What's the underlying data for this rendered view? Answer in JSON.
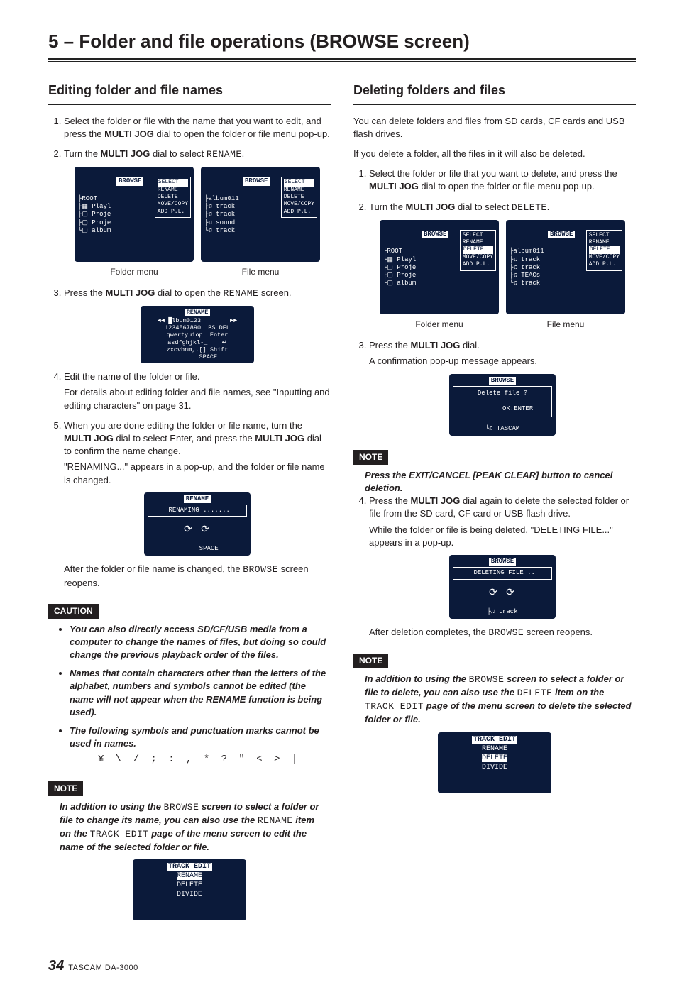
{
  "chapter": "5 – Folder and file operations (BROWSE screen)",
  "left": {
    "heading": "Editing folder and file names",
    "step1a": "Select the folder or file with the name that you want to edit, and press the ",
    "step1b": "MULTI JOG",
    "step1c": " dial to open the folder or file menu pop-up.",
    "step2a": "Turn the ",
    "step2c": " dial to select ",
    "rename_mono": "RENAME",
    "step2e": ".",
    "lcd1": {
      "title": "BROWSE",
      "lines": "├ROOT\n├▦ Playl\n├▢ Proje\n├▢ Proje\n└▢ album",
      "popup": [
        "SELECT",
        "RENAME",
        "DELETE",
        "MOVE/COPY",
        "ADD P.L."
      ]
    },
    "lcd2": {
      "title": "BROWSE",
      "lines": "├album011\n├♫ track\n├♫ track\n├♫ sound\n└♫ track",
      "popup": [
        "SELECT",
        "RENAME",
        "DELETE",
        "MOVE/COPY",
        "ADD P.L."
      ]
    },
    "cap_folder": "Folder menu",
    "cap_file": "File menu",
    "step3a": "Press the ",
    "step3c": " dial to open the ",
    "step3e": " screen.",
    "lcd_kbd_title": "RENAME",
    "lcd_kbd": "◄◄ █lbum0123        ►►\n1234567890  BS DEL\nqwertyuiop  Enter\nasdfghjkl-_    ↵\nzxcvbnm,.[] Shift\n      SPACE",
    "step4a": "Edit the name of the folder or file.",
    "step4b": "For details about editing folder and file names, see \"Inputting and editing characters\" on page 31.",
    "step5a": "When you are done editing the folder or file name, turn the ",
    "step5c": " dial to select Enter, and press the ",
    "step5e": " dial to confirm the name change.",
    "step5f": "\"RENAMING...\" appears in a pop-up, and the folder or file name is changed.",
    "lcd_renaming_title": "RENAME",
    "lcd_renaming_line": " RENAMING .......",
    "spinner": "⟳ ⟳",
    "lcd_renaming_footer": "      SPACE",
    "after_rename_a": "After the folder or file name is changed, the ",
    "browse_mono": "BROWSE",
    "after_rename_b": " screen reopens.",
    "caution_label": "CAUTION",
    "caution1": "You can also directly access SD/CF/USB media from a computer to change the names of files, but doing so could change the previous playback order of the files.",
    "caution2": "Names that contain characters other than the letters of the alphabet, numbers and symbols cannot be edited (the name will not appear when the RENAME function is being used).",
    "caution3": "The following symbols and punctuation marks cannot be used in names.",
    "symbols": "¥ \\ / ; : , * ? \" < > |",
    "note_label": "NOTE",
    "note_a": "In addition to using the ",
    "note_b": " screen to select a folder or file to change its name, you can also use the ",
    "note_c": " item on the ",
    "track_edit_mono": "TRACK EDIT",
    "note_d": " page of the menu screen to edit the name of the selected folder or file.",
    "lcd_track_title": "TRACK EDIT",
    "lcd_track_items": [
      "RENAME",
      "DELETE",
      "DIVIDE"
    ]
  },
  "right": {
    "heading": "Deleting folders and files",
    "p1": "You can delete folders and files from SD cards, CF cards and USB flash drives.",
    "p2": "If you delete a folder, all the files in it will also be deleted.",
    "step1a": "Select the folder or file that you want to delete, and press the ",
    "step1b": "MULTI JOG",
    "step1c": " dial to open the folder or file menu pop-up.",
    "step2a": "Turn the ",
    "step2c": " dial to select ",
    "delete_mono": "DELETE",
    "step2e": ".",
    "lcd1": {
      "title": "BROWSE",
      "lines": "├ROOT\n├▦ Playl\n├▢ Proje\n├▢ Proje\n└▢ album",
      "popup": [
        "SELECT",
        "RENAME",
        "DELETE",
        "MOVE/COPY",
        "ADD P.L."
      ]
    },
    "lcd2": {
      "title": "BROWSE",
      "lines": "├album011\n├♫ track\n├♫ track\n├♫ TEACs\n└♫ track",
      "popup": [
        "SELECT",
        "RENAME",
        "DELETE",
        "MOVE/COPY",
        "ADD P.L."
      ]
    },
    "cap_folder": "Folder menu",
    "cap_file": "File menu",
    "step3a": "Press the ",
    "step3c": " dial.",
    "step3_sub": "A confirmation pop-up message appears.",
    "lcd_confirm_title": "BROWSE",
    "lcd_confirm_line1": "Delete file ?",
    "lcd_confirm_line2": "        OK:ENTER",
    "lcd_confirm_footer": "└♫ TASCAM",
    "note1_label": "NOTE",
    "note1_a": "Press the ",
    "note1_b": "EXIT/CANCEL [PEAK CLEAR]",
    "note1_c": " button to cancel deletion.",
    "step4a": "Press the ",
    "step4c": " dial again to delete the selected folder or file from the SD card, CF card or USB flash drive.",
    "step4d": "While the folder or file is being deleted, \"DELETING FILE...\" appears in a pop-up.",
    "lcd_deleting_title": "BROWSE",
    "lcd_deleting_line": " DELETING FILE ..",
    "spinner": "⟳ ⟳",
    "lcd_deleting_footer": "├♫ track",
    "after_del_a": "After deletion completes, the ",
    "browse_mono": "BROWSE",
    "after_del_b": " screen reopens.",
    "note2_label": "NOTE",
    "note2_a": "In addition to using the ",
    "note2_b": " screen to select a folder or file to delete, you can also use the ",
    "note2_c": " item on the ",
    "track_edit_mono": "TRACK EDIT",
    "note2_d": " page of the menu screen to delete the selected folder or file.",
    "lcd_track_title": "TRACK EDIT",
    "lcd_track_items": [
      "RENAME",
      "DELETE",
      "DIVIDE"
    ]
  },
  "footer": {
    "page": "34",
    "product": "TASCAM  DA-3000"
  }
}
